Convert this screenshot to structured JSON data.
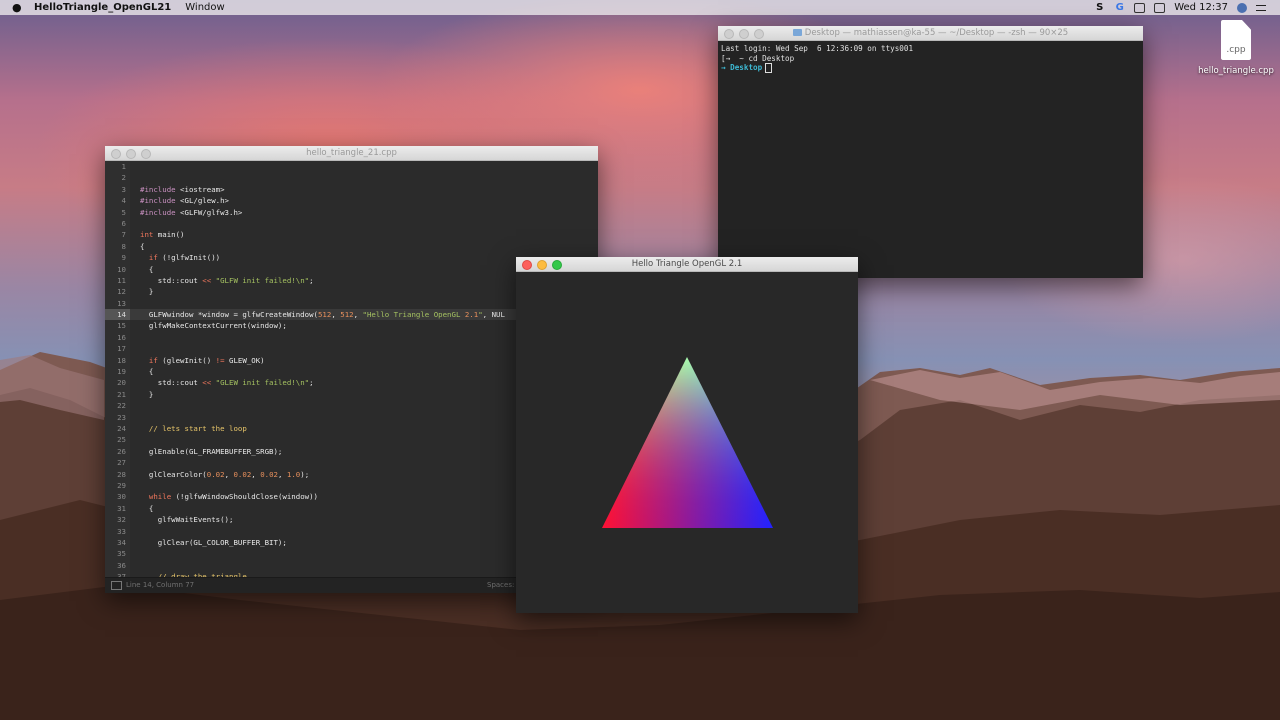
{
  "menubar": {
    "app_name": "HelloTriangle_OpenGL21",
    "menus": [
      "Window"
    ],
    "clock": "Wed 12:37",
    "status_icons": [
      "skype-icon",
      "google-drive-icon",
      "airplay-icon",
      "display-icon",
      "user-avatar-icon",
      "menu-list-icon"
    ]
  },
  "desktop": {
    "file": {
      "icon_text": ".cpp",
      "label": "hello_triangle.cpp"
    }
  },
  "editor": {
    "title": "hello_triangle_21.cpp",
    "current_line": 14,
    "status_left": "Line 14, Column 77",
    "status_right": "Spaces:",
    "lines": [
      {
        "n": "1",
        "t": ""
      },
      {
        "n": "2",
        "t": ""
      },
      {
        "n": "3",
        "t": "#include <iostream>"
      },
      {
        "n": "4",
        "t": "#include <GL/glew.h>"
      },
      {
        "n": "5",
        "t": "#include <GLFW/glfw3.h>"
      },
      {
        "n": "6",
        "t": ""
      },
      {
        "n": "7",
        "t": "int main()"
      },
      {
        "n": "8",
        "t": "{"
      },
      {
        "n": "9",
        "t": "  if (!glfwInit())"
      },
      {
        "n": "10",
        "t": "  {"
      },
      {
        "n": "11",
        "t": "    std::cout << \"GLFW init failed!\\n\";"
      },
      {
        "n": "12",
        "t": "  }"
      },
      {
        "n": "13",
        "t": ""
      },
      {
        "n": "14",
        "t": "  GLFWwindow *window = glfwCreateWindow(512, 512, \"Hello Triangle OpenGL 2.1\", NUL"
      },
      {
        "n": "15",
        "t": "  glfwMakeContextCurrent(window);"
      },
      {
        "n": "16",
        "t": ""
      },
      {
        "n": "17",
        "t": ""
      },
      {
        "n": "18",
        "t": "  if (glewInit() != GLEW_OK)"
      },
      {
        "n": "19",
        "t": "  {"
      },
      {
        "n": "20",
        "t": "    std::cout << \"GLEW init failed!\\n\";"
      },
      {
        "n": "21",
        "t": "  }"
      },
      {
        "n": "22",
        "t": ""
      },
      {
        "n": "23",
        "t": ""
      },
      {
        "n": "24",
        "t": "  // lets start the loop"
      },
      {
        "n": "25",
        "t": ""
      },
      {
        "n": "26",
        "t": "  glEnable(GL_FRAMEBUFFER_SRGB);"
      },
      {
        "n": "27",
        "t": ""
      },
      {
        "n": "28",
        "t": "  glClearColor(0.02, 0.02, 0.02, 1.0);"
      },
      {
        "n": "29",
        "t": ""
      },
      {
        "n": "30",
        "t": "  while (!glfwWindowShouldClose(window))"
      },
      {
        "n": "31",
        "t": "  {"
      },
      {
        "n": "32",
        "t": "    glfwWaitEvents();"
      },
      {
        "n": "33",
        "t": ""
      },
      {
        "n": "34",
        "t": "    glClear(GL_COLOR_BUFFER_BIT);"
      },
      {
        "n": "35",
        "t": ""
      },
      {
        "n": "36",
        "t": ""
      },
      {
        "n": "37",
        "t": "    // draw the triangle"
      }
    ]
  },
  "terminal": {
    "title": "Desktop — mathiassen@ka-55 — ~/Desktop — -zsh — 90×25",
    "last_login": "Last login: Wed Sep  6 12:36:09 on ttys001",
    "cmd_prefix": "[→  ~ ",
    "cmd": "cd Desktop",
    "prompt_arrow": "→ ",
    "prompt_dir": "Desktop"
  },
  "gl_window": {
    "title": "Hello Triangle OpenGL 2.1",
    "triangle_colors": {
      "top": "#33ff33",
      "bottom_left": "#ff1133",
      "bottom_right": "#2222ff"
    }
  }
}
